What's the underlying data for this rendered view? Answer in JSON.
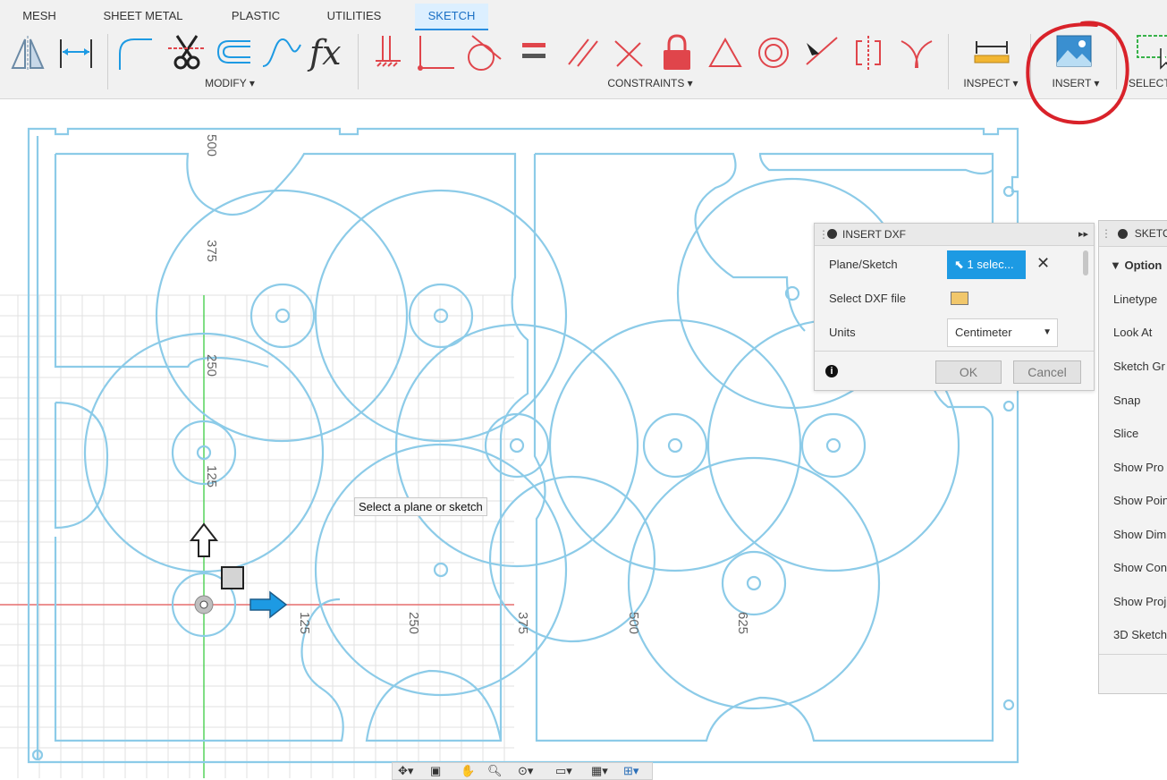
{
  "tabs": [
    {
      "label": "MESH"
    },
    {
      "label": "SHEET METAL"
    },
    {
      "label": "PLASTIC"
    },
    {
      "label": "UTILITIES"
    },
    {
      "label": "SKETCH",
      "active": true
    }
  ],
  "groups": {
    "modify": "MODIFY ▾",
    "constraints": "CONSTRAINTS ▾",
    "inspect": "INSPECT ▾",
    "insert": "INSERT ▾",
    "select": "SELECT"
  },
  "tools": {
    "fx_label": "fx"
  },
  "ruler": {
    "vertical": [
      "500",
      "375",
      "250",
      "125"
    ],
    "horizontal": [
      "125",
      "250",
      "375",
      "500",
      "625"
    ]
  },
  "tooltip": "Select a plane or sketch",
  "insert_dxf": {
    "title": "INSERT DXF",
    "plane_label": "Plane/Sketch",
    "plane_value": "1 selec...",
    "file_label": "Select DXF file",
    "units_label": "Units",
    "units_value": "Centimeter",
    "ok": "OK",
    "cancel": "Cancel"
  },
  "sketch_palette": {
    "title": "SKETCH",
    "section": "Option",
    "items": [
      "Linetype",
      "Look At",
      "Sketch Gr",
      "Snap",
      "Slice",
      "Show Pro",
      "Show Poin",
      "Show Dim",
      "Show Con",
      "Show Proj",
      "3D Sketch"
    ]
  },
  "colors": {
    "sketch_line": "#8ccbe8",
    "accent": "#1d9ae3",
    "annotation_red": "#d9222a",
    "constraint_red": "#e0454b"
  }
}
